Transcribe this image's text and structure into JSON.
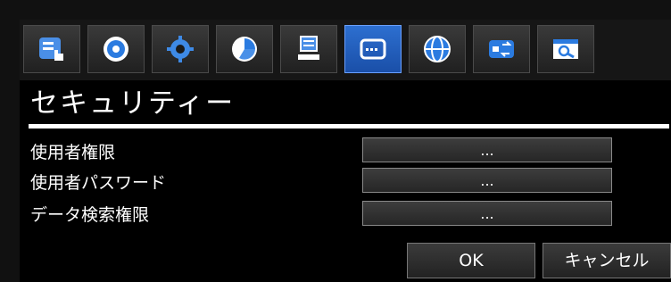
{
  "toolbar": {
    "icons": [
      "hand-menu-icon",
      "record-icon",
      "settings-gear-icon",
      "pie-chart-icon",
      "computer-icon",
      "keyboard-icon",
      "globe-icon",
      "swap-icon",
      "search-icon"
    ],
    "active_index": 5
  },
  "dialog": {
    "title": "セキュリティー",
    "rows": [
      {
        "label": "使用者権限",
        "value": "..."
      },
      {
        "label": "使用者パスワード",
        "value": "..."
      },
      {
        "label": "データ検索権限",
        "value": "..."
      }
    ],
    "ok_label": "OK",
    "cancel_label": "キャンセル"
  },
  "colors": {
    "accent": "#1a4fa8",
    "background": "#000000",
    "text": "#ffffff"
  }
}
